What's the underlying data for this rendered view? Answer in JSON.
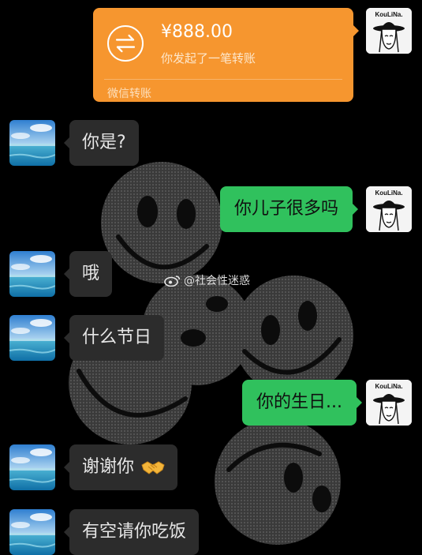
{
  "transfer": {
    "amount": "¥888.00",
    "description": "你发起了一笔转账",
    "footer": "微信转账"
  },
  "messages": {
    "m1": "你是?",
    "m2": "你儿子很多吗",
    "m3": "哦",
    "m4": "什么节日",
    "m5": "你的生日...",
    "m6": "谢谢你",
    "m7": "有空请你吃饭"
  },
  "avatar_right": {
    "brand": "KouLiNa."
  },
  "watermark": "@社会性迷惑",
  "icons": {
    "transfer": "transfer-arrows-icon",
    "emoji": "handshake-emoji-icon",
    "watermark": "weibo-logo-icon"
  },
  "colors": {
    "background": "#000000",
    "transfer_card": "#f6962f",
    "my_bubble": "#30c15d",
    "their_bubble": "#2c2c2c"
  }
}
